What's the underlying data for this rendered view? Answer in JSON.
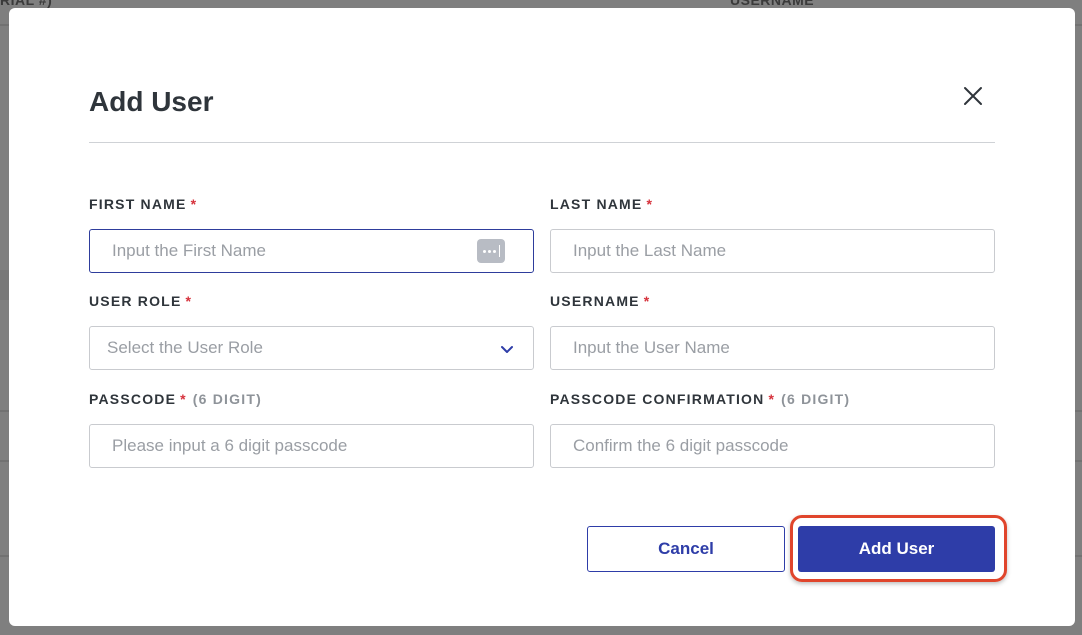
{
  "background": {
    "table_headers": [
      "RIAL #)",
      "USERNAME"
    ]
  },
  "modal": {
    "title": "Add User",
    "close_icon": "close-icon",
    "fields": [
      {
        "label": "FIRST NAME",
        "required": "*",
        "hint": "",
        "placeholder": "Input the First Name",
        "value": "",
        "type": "text",
        "focused": true,
        "icon": "password-manager-icon"
      },
      {
        "label": "LAST NAME",
        "required": "*",
        "hint": "",
        "placeholder": "Input the Last Name",
        "value": "",
        "type": "text"
      },
      {
        "label": "USER ROLE",
        "required": "*",
        "hint": "",
        "placeholder": "Select the User Role",
        "value": "",
        "type": "select",
        "icon": "chevron-down-icon"
      },
      {
        "label": "USERNAME",
        "required": "*",
        "hint": "",
        "placeholder": "Input the User Name",
        "value": "",
        "type": "text"
      },
      {
        "label": "PASSCODE",
        "required": "*",
        "hint": "(6 DIGIT)",
        "placeholder": "Please input a 6 digit passcode",
        "value": "",
        "type": "password"
      },
      {
        "label": "PASSCODE CONFIRMATION",
        "required": "*",
        "hint": "(6 DIGIT)",
        "placeholder": "Confirm the 6 digit passcode",
        "value": "",
        "type": "password"
      }
    ],
    "buttons": {
      "cancel": "Cancel",
      "submit": "Add User"
    }
  },
  "colors": {
    "primary": "#2e3da8",
    "required": "#d6323c",
    "highlight": "#e0452c"
  }
}
